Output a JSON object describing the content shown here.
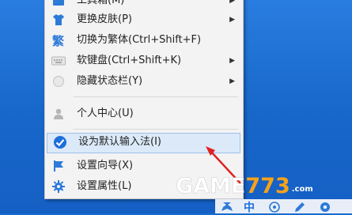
{
  "menu": {
    "items": [
      {
        "label": "工具箱(M)",
        "icon": "toolbox-icon",
        "submenu": true
      },
      {
        "label": "更换皮肤(P)",
        "icon": "shirt-icon",
        "submenu": true
      },
      {
        "label": "切换为繁体(Ctrl+Shift+F)",
        "icon": "traditional-chinese-icon",
        "submenu": false
      },
      {
        "label": "软键盘(Ctrl+Shift+K)",
        "icon": "keyboard-icon",
        "submenu": true
      },
      {
        "label": "隐藏状态栏(Y)",
        "icon": "hide-statusbar-icon",
        "submenu": true
      },
      {
        "label": "个人中心(U)",
        "icon": "user-icon",
        "submenu": false
      },
      {
        "label": "设为默认输入法(I)",
        "icon": "checkmark-icon",
        "submenu": false,
        "highlighted": true
      },
      {
        "label": "设置向导(X)",
        "icon": "flag-icon",
        "submenu": false
      },
      {
        "label": "设置属性(L)",
        "icon": "gear-icon",
        "submenu": false
      }
    ]
  },
  "annotation": {
    "color": "#e02020"
  },
  "watermark": {
    "game": "GAME",
    "num": "773",
    "com": ".com"
  },
  "taskbar": {
    "lang": "中"
  },
  "colors": {
    "highlight": "#dbe9f8",
    "accent": "#1e6fd9",
    "desktop": "#1a6bd0"
  }
}
